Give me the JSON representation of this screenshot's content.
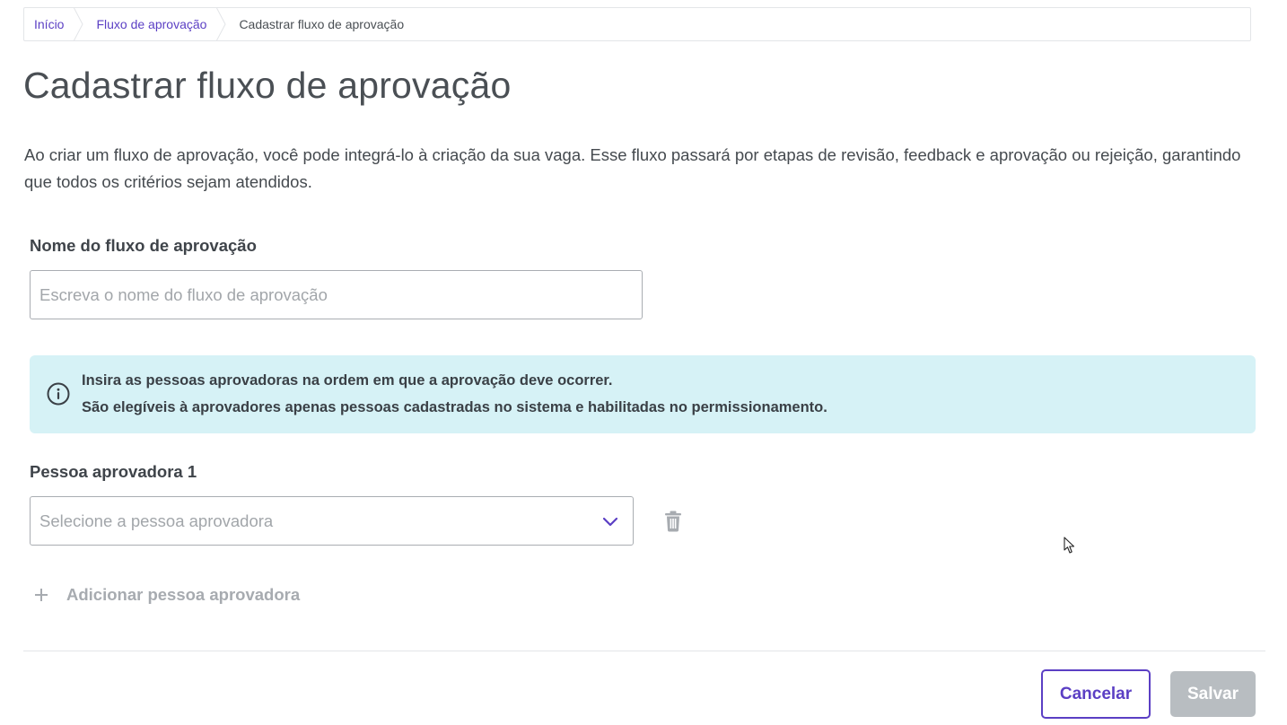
{
  "breadcrumb": {
    "items": [
      {
        "label": "Início"
      },
      {
        "label": "Fluxo de aprovação"
      },
      {
        "label": "Cadastrar fluxo de aprovação"
      }
    ]
  },
  "page": {
    "title": "Cadastrar fluxo de aprovação",
    "description": "Ao criar um fluxo de aprovação, você pode integrá-lo à criação da sua vaga. Esse fluxo passará por etapas de revisão, feedback e aprovação ou rejeição, garantindo que todos os critérios sejam atendidos."
  },
  "form": {
    "name_label": "Nome do fluxo de aprovação",
    "name_value": "",
    "name_placeholder": "Escreva o nome do fluxo de aprovação",
    "alert": {
      "icon": "info-icon",
      "line1": "Insira as pessoas aprovadoras na ordem em que a aprovação deve ocorrer.",
      "line2": "São elegíveis à aprovadores apenas pessoas cadastradas no sistema e habilitadas no permissionamento."
    },
    "approvers": [
      {
        "label": "Pessoa aprovadora 1",
        "placeholder": "Selecione a pessoa aprovadora"
      }
    ],
    "add_approver_label": "Adicionar pessoa aprovadora"
  },
  "actions": {
    "cancel_label": "Cancelar",
    "save_label": "Salvar"
  },
  "colors": {
    "accent": "#5b3fc4",
    "alert_bg": "#d6f2f6",
    "disabled_button": "#b8bdc1"
  }
}
